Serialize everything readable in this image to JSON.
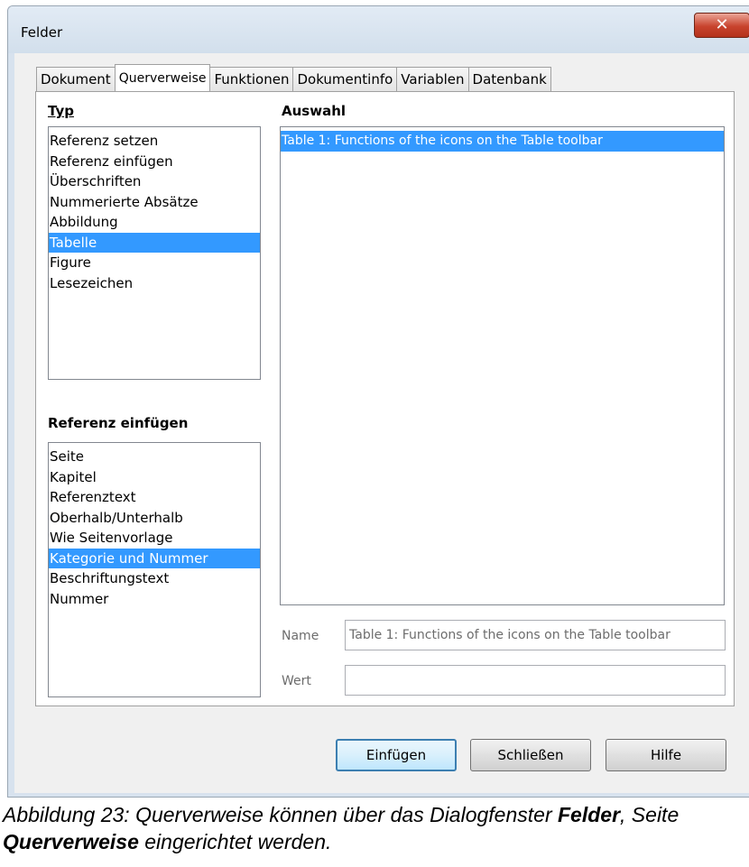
{
  "window": {
    "title": "Felder",
    "close_symbol": "✕"
  },
  "tabs": [
    "Dokument",
    "Querverweise",
    "Funktionen",
    "Dokumentinfo",
    "Variablen",
    "Datenbank"
  ],
  "active_tab": "Querverweise",
  "type_section": {
    "label": "Typ",
    "items": [
      "Referenz setzen",
      "Referenz einfügen",
      "Überschriften",
      "Nummerierte Absätze",
      "Abbildung",
      "Tabelle",
      "Figure",
      "Lesezeichen"
    ],
    "selected": "Tabelle"
  },
  "insert_ref_section": {
    "label": "Referenz einfügen",
    "items": [
      "Seite",
      "Kapitel",
      "Referenztext",
      "Oberhalb/Unterhalb",
      "Wie Seitenvorlage",
      "Kategorie und Nummer",
      "Beschriftungstext",
      "Nummer"
    ],
    "selected": "Kategorie und Nummer"
  },
  "selection_section": {
    "label": "Auswahl",
    "items": [
      "Table 1: Functions of the icons on the Table toolbar"
    ],
    "selected": "Table 1: Functions of the icons on the Table toolbar"
  },
  "name_field": {
    "label": "Name",
    "value": "Table 1: Functions of the icons on the Table toolbar"
  },
  "value_field": {
    "label": "Wert",
    "value": ""
  },
  "buttons": {
    "insert": "Einfügen",
    "close": "Schließen",
    "help": "Hilfe"
  },
  "caption": {
    "part1": "Abbildung 23: Querverweise können über das Dialogfenster ",
    "bold1": "Felder",
    "part2": ", Seite ",
    "bold2": "Querverweise",
    "part3": " eingerichtet werden."
  }
}
